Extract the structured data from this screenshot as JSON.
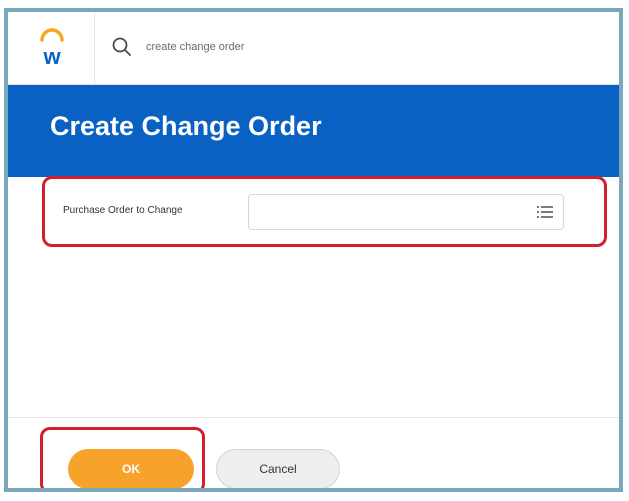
{
  "topbar": {
    "logo_icon": "workday-logo-icon",
    "search_icon": "search-icon",
    "search_value": "create change order"
  },
  "header": {
    "title": "Create Change Order"
  },
  "form": {
    "field_label": "Purchase Order to Change",
    "field_value": "",
    "prompt_icon": "list-prompt-icon"
  },
  "footer": {
    "ok_label": "OK",
    "cancel_label": "Cancel"
  },
  "colors": {
    "header_blue": "#0a61c4",
    "ok_orange": "#f7a22a",
    "highlight_red": "#d11f2c",
    "frame_border": "#7ba7bc"
  }
}
